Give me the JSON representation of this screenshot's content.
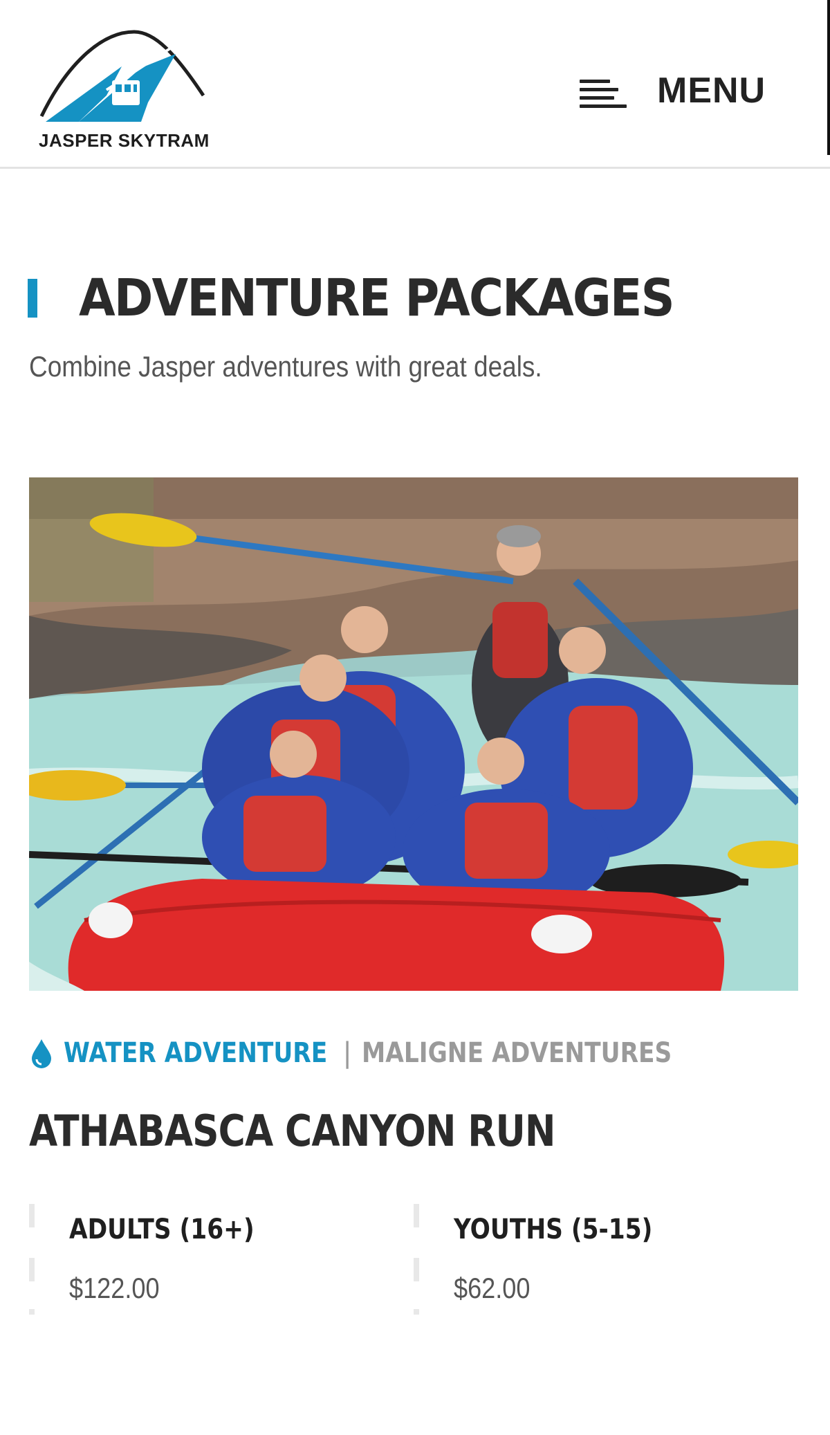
{
  "header": {
    "logo_text": "JASPER SKYTRAM",
    "menu_label": "MENU",
    "brand_color": "#1592c3"
  },
  "section": {
    "title": "ADVENTURE PACKAGES",
    "subtitle": "Combine Jasper adventures with great deals."
  },
  "package": {
    "image_icon": "rafting-photo",
    "category_icon": "water-drop-icon",
    "category_primary": "WATER ADVENTURE",
    "category_separator": "|",
    "category_secondary": "MALIGNE ADVENTURES",
    "title": "ATHABASCA CANYON RUN",
    "prices": [
      {
        "label": "ADULTS (16+)",
        "value": "$122.00"
      },
      {
        "label": "YOUTHS (5-15)",
        "value": "$62.00"
      }
    ]
  },
  "colors": {
    "accent": "#1592c3",
    "text_dark": "#2b2b2b",
    "text_muted": "#9a9a9a"
  }
}
